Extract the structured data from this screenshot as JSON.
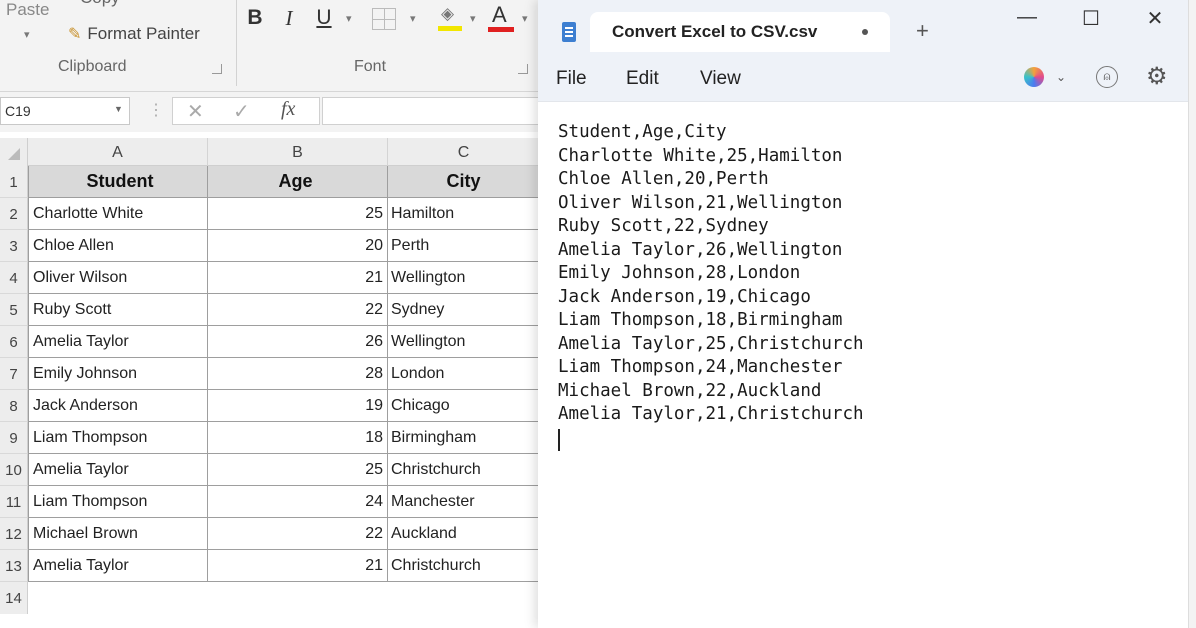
{
  "excel": {
    "ribbon": {
      "paste_label": "Paste",
      "copy_label": "Copy",
      "format_painter_label": "Format Painter",
      "clipboard_group": "Clipboard",
      "font_group": "Font",
      "bold": "B",
      "italic": "I",
      "underline": "U",
      "font_color_glyph": "A"
    },
    "formula_bar": {
      "name_box": "C19",
      "cancel_glyph": "✕",
      "enter_glyph": "✓",
      "fx_glyph": "fx",
      "value": ""
    },
    "columns": [
      "A",
      "B",
      "C"
    ],
    "header_row": {
      "num": "1",
      "a": "Student",
      "b": "Age",
      "c": "City"
    },
    "rows": [
      {
        "num": "2",
        "a": "Charlotte White",
        "b": "25",
        "c": "Hamilton"
      },
      {
        "num": "3",
        "a": "Chloe Allen",
        "b": "20",
        "c": "Perth"
      },
      {
        "num": "4",
        "a": "Oliver Wilson",
        "b": "21",
        "c": "Wellington"
      },
      {
        "num": "5",
        "a": "Ruby Scott",
        "b": "22",
        "c": "Sydney"
      },
      {
        "num": "6",
        "a": "Amelia Taylor",
        "b": "26",
        "c": "Wellington"
      },
      {
        "num": "7",
        "a": "Emily Johnson",
        "b": "28",
        "c": "London"
      },
      {
        "num": "8",
        "a": "Jack Anderson",
        "b": "19",
        "c": "Chicago"
      },
      {
        "num": "9",
        "a": "Liam Thompson",
        "b": "18",
        "c": "Birmingham"
      },
      {
        "num": "10",
        "a": "Amelia Taylor",
        "b": "25",
        "c": "Christchurch"
      },
      {
        "num": "11",
        "a": "Liam Thompson",
        "b": "24",
        "c": "Manchester"
      },
      {
        "num": "12",
        "a": "Michael Brown",
        "b": "22",
        "c": "Auckland"
      },
      {
        "num": "13",
        "a": "Amelia Taylor",
        "b": "21",
        "c": "Christchurch"
      }
    ],
    "empty_row_num": "14"
  },
  "notepad": {
    "tab_title": "Convert Excel to CSV.csv",
    "new_tab_glyph": "+",
    "controls": {
      "minimize": "—",
      "maximize": "☐",
      "close": "✕"
    },
    "menu": {
      "file": "File",
      "edit": "Edit",
      "view": "View"
    },
    "icons": {
      "copilot": "copilot-icon",
      "account": "account-icon",
      "settings": "gear-icon"
    },
    "lines": [
      "Student,Age,City",
      "Charlotte White,25,Hamilton",
      "Chloe Allen,20,Perth",
      "Oliver Wilson,21,Wellington",
      "Ruby Scott,22,Sydney",
      "Amelia Taylor,26,Wellington",
      "Emily Johnson,28,London",
      "Jack Anderson,19,Chicago",
      "Liam Thompson,18,Birmingham",
      "Amelia Taylor,25,Christchurch",
      "Liam Thompson,24,Manchester",
      "Michael Brown,22,Auckland",
      "Amelia Taylor,21,Christchurch"
    ]
  },
  "colors": {
    "ribbon_bg": "#f3f3f3",
    "header_fill": "#d9d9d9",
    "notepad_title_bg": "#eef2f8",
    "font_color_red": "#e02020",
    "highlight_yellow": "#f2e600",
    "notepad_icon_blue": "#3d7fd1"
  }
}
